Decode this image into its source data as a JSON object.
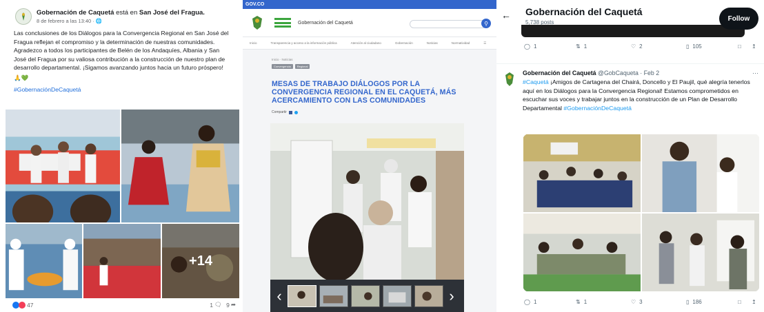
{
  "facebook": {
    "page_name": "Gobernación de Caquetá",
    "action_text": "está en",
    "location": "San José del Fragua.",
    "timestamp": "8 de febrero a las 13:40 ·",
    "body": "Las conclusiones de los Diálogos para la Convergencia Regional en San José del Fragua reflejan el compromiso y la determinación de nuestras comunidades. Agradezco a todos los participantes de Belén de los Andaquíes, Albania y San José del Fragua por su valiosa contribución a la construcción de nuestro plan de desarrollo departamental. ¡Sigamos avanzando juntos hacia un futuro próspero!",
    "hashtag": "#GobernaciónDeCaquetá",
    "more_photos": "+14",
    "reactions_count": "47",
    "comments_count": "1",
    "shares_count": "9"
  },
  "gov": {
    "top_bar": "GOV.CO",
    "site_title": "Gobernación del Caquetá",
    "nav": [
      "Inicio",
      "Transparencia y acceso a la información pública",
      "Atención al ciudadano",
      "Gobernación",
      "Noticias",
      "Normatividad"
    ],
    "breadcrumb": "Inicio · Noticias",
    "tags": [
      "Convergencia",
      "Regional"
    ],
    "headline": "MESAS DE TRABAJO DIÁLOGOS POR LA CONVERGENCIA REGIONAL EN EL CAQUETÁ, MÁS ACERCAMIENTO CON LAS COMUNIDADES",
    "share_label": "Compartir"
  },
  "twitter": {
    "profile_name": "Gobernación del Caquetá",
    "post_count": "5,738 posts",
    "follow_label": "Follow",
    "top_actions": {
      "replies": "1",
      "reposts": "1",
      "likes": "2",
      "views": "105"
    },
    "author_name": "Gobernación del Caquetá",
    "handle_date": "@GobCaqueta · Feb 2",
    "hashtag_start": "#Caquetá",
    "text_body": " ¡Amigos de Cartagena del Chairá, Doncello y El Paujil, qué alegría tenerlos aquí en los Diálogos para la Convergencia Regional! Estamos comprometidos en escuchar sus voces y trabajar juntos en la construcción de un Plan de Desarrollo Departamental ",
    "hashtag_end": "#GobernaciónDeCaquetá",
    "bottom_actions": {
      "replies": "1",
      "reposts": "1",
      "likes": "3",
      "views": "186"
    }
  },
  "colors": {
    "gov_blue": "#3366cc",
    "fb_link": "#216fdb",
    "x_link": "#1d9bf0"
  }
}
